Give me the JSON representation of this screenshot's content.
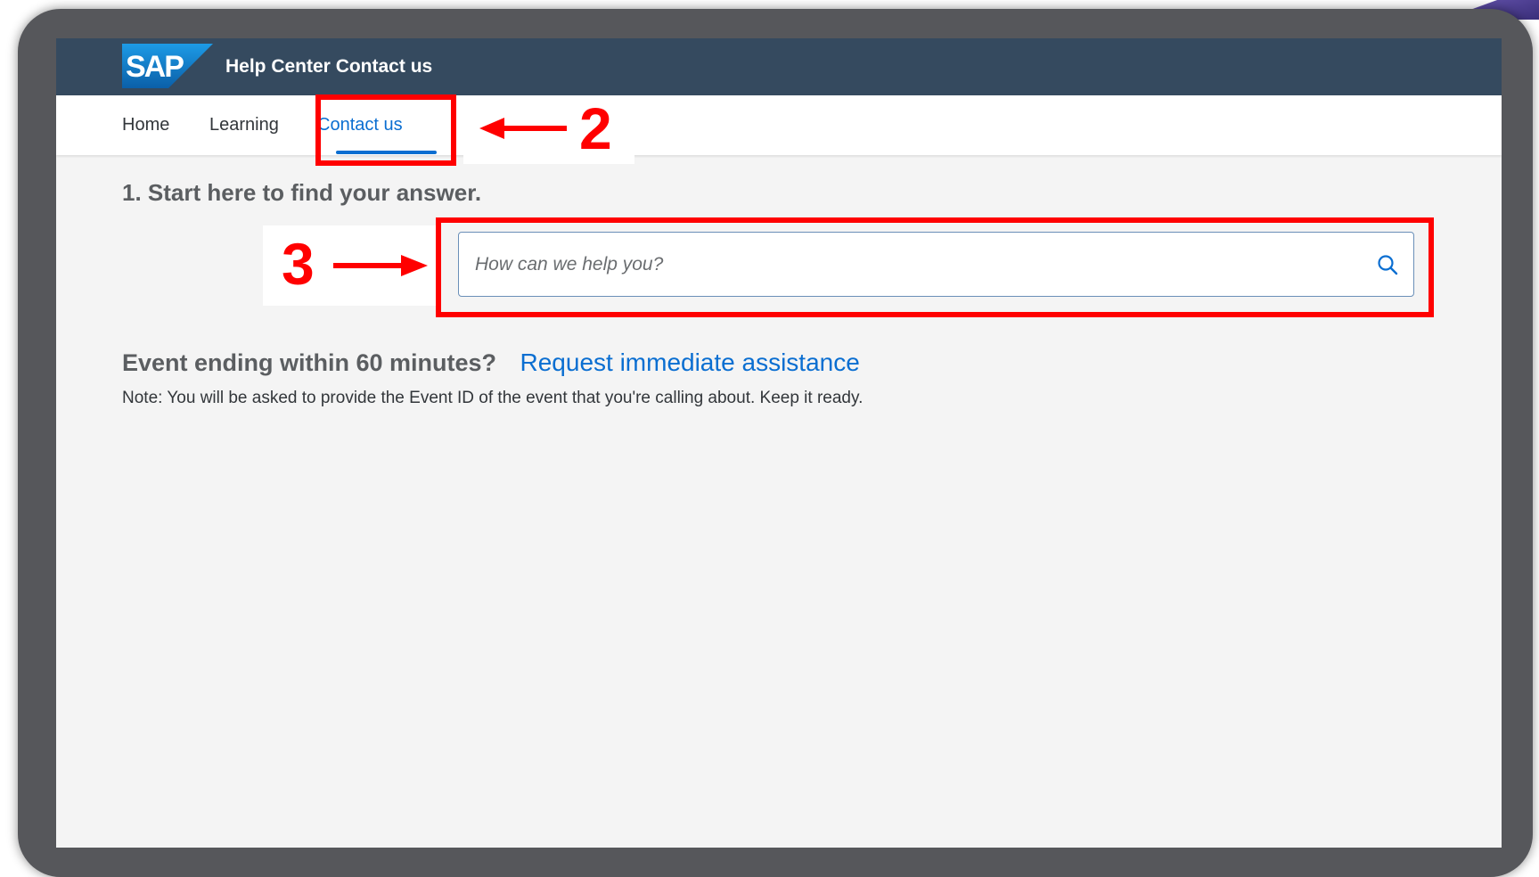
{
  "app": {
    "logo_text": "SAP",
    "title": "Help Center Contact us",
    "brand_color": "#354a5f",
    "accent_color": "#0a6ed1"
  },
  "tabs": [
    {
      "label": "Home",
      "active": false
    },
    {
      "label": "Learning",
      "active": false
    },
    {
      "label": "Contact us",
      "active": true
    }
  ],
  "main": {
    "section_title": "1. Start here to find your answer.",
    "search": {
      "placeholder": "How can we help you?",
      "value": "",
      "icon": "search-icon"
    },
    "event_question": "Event ending within 60 minutes?",
    "event_link": "Request immediate assistance",
    "note": "Note: You will be asked to provide the Event ID of the event that you're calling about. Keep it ready."
  },
  "annotations": {
    "step2_label": "2",
    "step3_label": "3",
    "color": "#ff0000"
  }
}
